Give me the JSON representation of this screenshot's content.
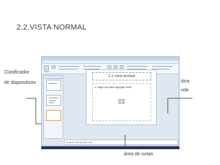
{
  "slide": {
    "title": "2.2.VISTA NORMAL"
  },
  "labels": {
    "clasificador_line1": "Clasificador",
    "clasificador_line2": "de diapositivas",
    "right_fragment_1": "itiva",
    "right_fragment_2": "nde",
    "notes_area": "área de notas"
  },
  "powerpoint": {
    "title_placeholder": "2.2.vista normal",
    "body_placeholder": "Haga clic para agregar texto",
    "notes_placeholder": "Haga clic para agregar notas"
  },
  "colors": {
    "accent_line": "#666666",
    "window_frame": "#9fb2c8",
    "file_tab": "#b04a1a",
    "taskbar": "#24334a"
  }
}
